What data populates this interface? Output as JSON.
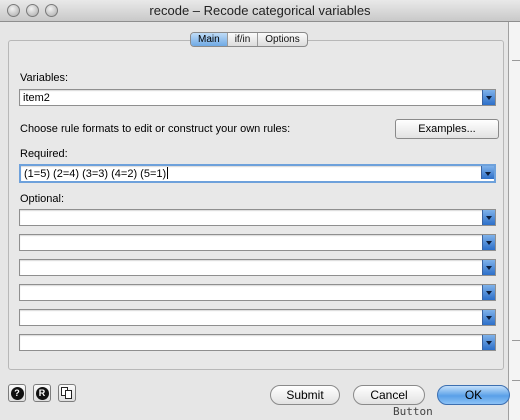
{
  "window": {
    "title": "recode – Recode categorical variables"
  },
  "tabs": [
    {
      "label": "Main",
      "active": true
    },
    {
      "label": "if/in",
      "active": false
    },
    {
      "label": "Options",
      "active": false
    }
  ],
  "variables": {
    "label": "Variables:",
    "value": "item2"
  },
  "rules": {
    "instruction": "Choose rule formats to edit or construct your own rules:",
    "examples_button": "Examples...",
    "required_label": "Required:",
    "required_value": "(1=5) (2=4) (3=3) (4=2) (5=1)",
    "optional_label": "Optional:",
    "optional_values": [
      "",
      "",
      "",
      "",
      "",
      ""
    ]
  },
  "footer": {
    "help_icon": "?",
    "reset_icon": "R",
    "copy_icon": "copy-icon",
    "submit_label": "Submit",
    "cancel_label": "Cancel",
    "ok_label": "OK"
  },
  "background": {
    "peek_text": "Button"
  },
  "colors": {
    "accent": "#5aa0e8",
    "combo_button": "#2d6fc8"
  }
}
